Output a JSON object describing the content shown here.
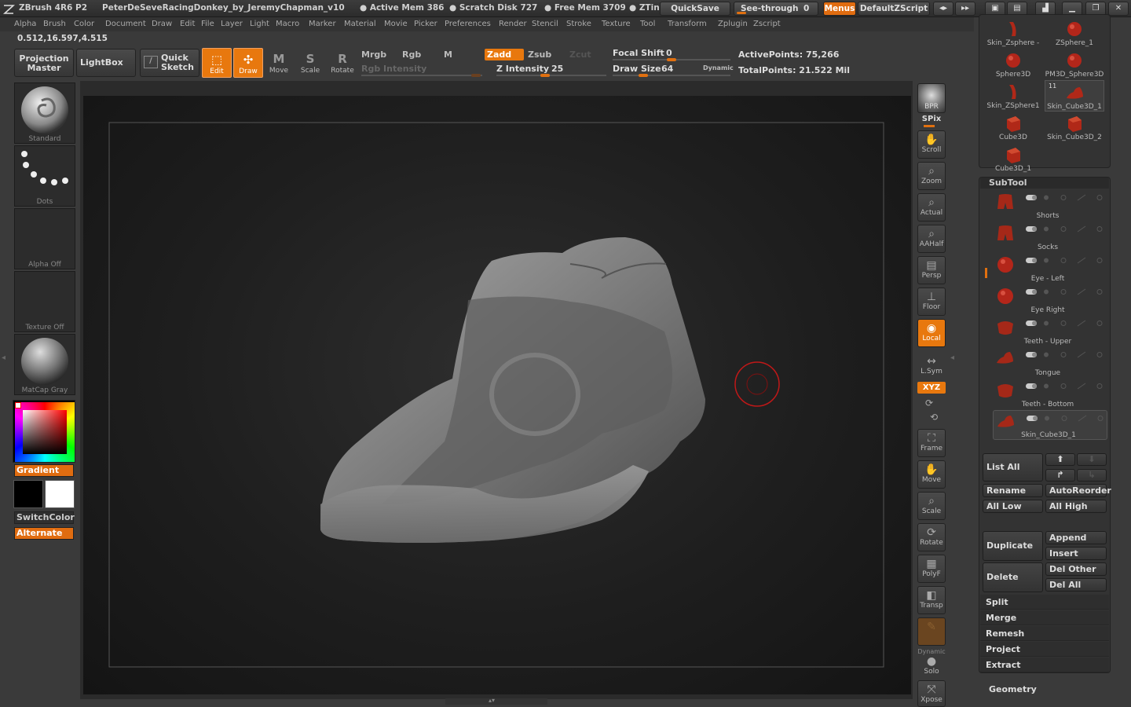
{
  "title_bar": {
    "app_name": "ZBrush 4R6 P2",
    "document_name": "PeterDeSeveRacingDonkey_by_JeremyChapman_v10",
    "active_mem": "● Active Mem 386",
    "scratch_disk": "● Scratch Disk 727",
    "free_mem": "● Free Mem 3709",
    "ztime": "● ZTin",
    "quicksave_label": "QuickSave",
    "see_through_label": "See-through",
    "see_through_value": "0",
    "menus_label": "Menus",
    "default_zscript_label": "DefaultZScript"
  },
  "menu_bar": [
    "Alpha",
    "Brush",
    "Color",
    "Document",
    "Draw",
    "Edit",
    "File",
    "Layer",
    "Light",
    "Macro",
    "Marker",
    "Material",
    "Movie",
    "Picker",
    "Preferences",
    "Render",
    "Stencil",
    "Stroke",
    "Texture",
    "Tool",
    "Transform",
    "Zplugin",
    "Zscript"
  ],
  "coordinates": "0.512,16.597,4.515",
  "toolbar": {
    "projection_master": "Projection Master",
    "lightbox": "LightBox",
    "quick_sketch": "Quick Sketch",
    "edit": "Edit",
    "draw": "Draw",
    "move": "Move",
    "scale": "Scale",
    "rotate": "Rotate",
    "mrgb": "Mrgb",
    "rgb": "Rgb",
    "m": "M",
    "rgb_intensity": "Rgb Intensity",
    "zadd": "Zadd",
    "zsub": "Zsub",
    "zcut": "Zcut",
    "z_intensity_label": "Z Intensity",
    "z_intensity_value": "25",
    "focal_shift_label": "Focal Shift",
    "focal_shift_value": "0",
    "draw_size_label": "Draw Size",
    "draw_size_value": "64",
    "dynamic": "Dynamic",
    "active_points": "ActivePoints: 75,266",
    "total_points": "TotalPoints: 21.522 Mil"
  },
  "left_palette": {
    "brush": "Standard",
    "stroke": "Dots",
    "alpha": "Alpha Off",
    "texture": "Texture Off",
    "material": "MatCap Gray",
    "gradient": "Gradient",
    "switch_color": "SwitchColor",
    "alternate": "Alternate"
  },
  "right_shelf": [
    "BPR",
    "SPix",
    "Scroll",
    "Zoom",
    "Actual",
    "AAHalf",
    "Persp",
    "Floor",
    "Local",
    "L.Sym",
    "XYZ",
    "Frame",
    "Move",
    "Scale",
    "Rotate",
    "PolyF",
    "Transp",
    "Dynamic",
    "Solo",
    "Xpose"
  ],
  "tool_list": [
    {
      "name": "Skin_Zsphere -",
      "shape": "figure"
    },
    {
      "name": "ZSphere_1",
      "shape": "sphere"
    },
    {
      "name": "Sphere3D",
      "shape": "sphere"
    },
    {
      "name": "PM3D_Sphere3D",
      "shape": "sphere"
    },
    {
      "name": "Skin_ZSphere1",
      "shape": "figure"
    },
    {
      "name": "Skin_Cube3D_1",
      "shape": "shoe",
      "count": "11"
    },
    {
      "name": "Cube3D",
      "shape": "cube"
    },
    {
      "name": "Skin_Cube3D_2",
      "shape": "cube"
    },
    {
      "name": "Cube3D_1",
      "shape": "cube"
    }
  ],
  "subtool": {
    "header": "SubTool",
    "items": [
      "Shorts",
      "Socks",
      "Eye - Left",
      "Eye Right",
      "Teeth - Upper",
      "Tongue",
      "Teeth - Bottom",
      "Skin_Cube3D_1"
    ],
    "buttons": {
      "list_all": "List All",
      "rename": "Rename",
      "auto_reorder": "AutoReorder",
      "all_low": "All Low",
      "all_high": "All High",
      "duplicate": "Duplicate",
      "append": "Append",
      "insert": "Insert",
      "delete": "Delete",
      "del_other": "Del Other",
      "del_all": "Del All"
    },
    "sections": [
      "Split",
      "Merge",
      "Remesh",
      "Project",
      "Extract"
    ]
  },
  "geometry_label": "Geometry",
  "colors": {
    "accent": "#e8780e",
    "primary_color": "#000000",
    "secondary_color": "#ffffff"
  }
}
